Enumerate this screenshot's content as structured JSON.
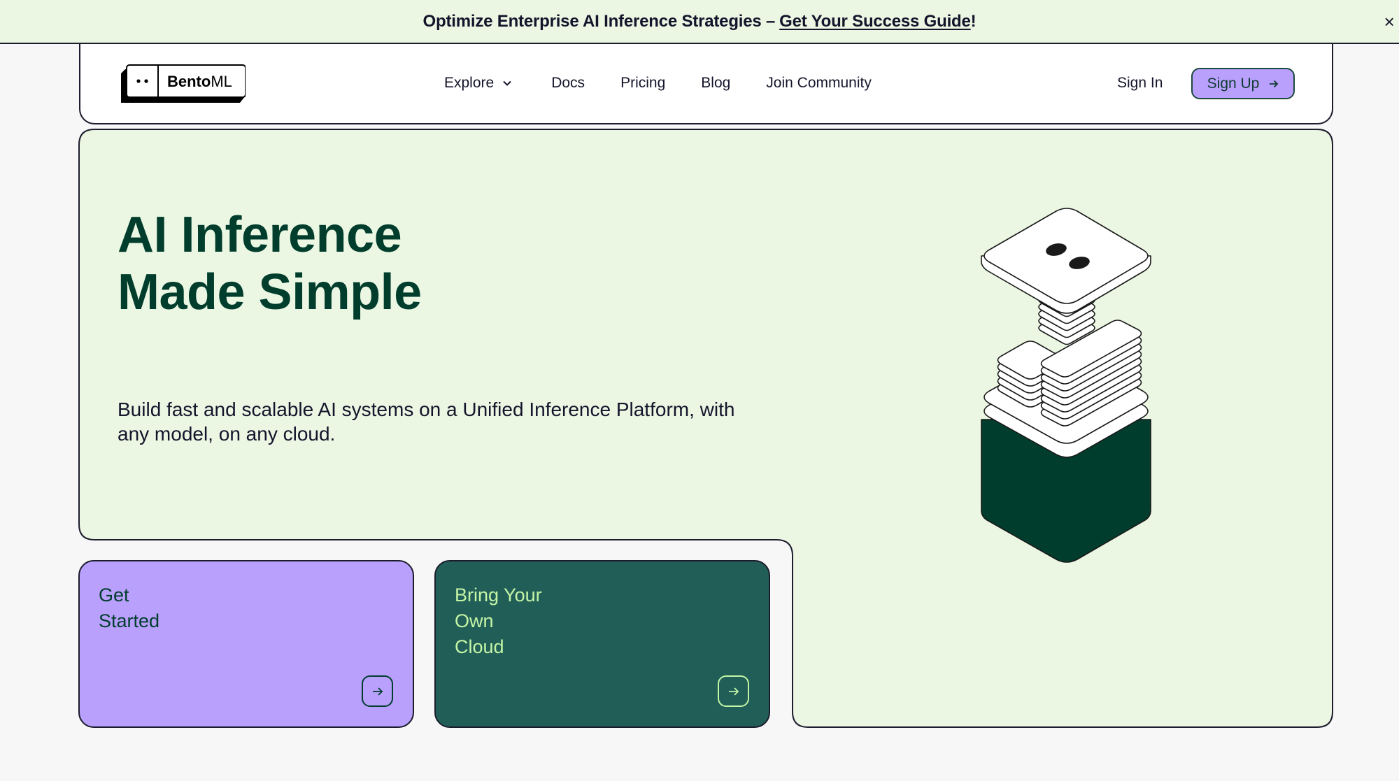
{
  "banner": {
    "text": "Optimize Enterprise AI Inference Strategies – ",
    "link": "Get Your Success Guide",
    "suffix": "!",
    "close_icon": "×"
  },
  "nav": {
    "logo_mark": "••",
    "logo_bold": "Bento",
    "logo_light": "ML",
    "links": [
      {
        "label": "Explore",
        "has_dropdown": true
      },
      {
        "label": "Docs"
      },
      {
        "label": "Pricing"
      },
      {
        "label": "Blog"
      },
      {
        "label": "Join Community"
      }
    ],
    "sign_in": "Sign In",
    "sign_up": "Sign Up",
    "sign_up_icon": "→"
  },
  "hero": {
    "title_line1": "AI Inference",
    "title_line2": "Made Simple",
    "subtitle": "Build fast and scalable AI systems on a Unified Inference Platform, with any model, on any cloud.",
    "illustration": "bento-stack-illustration"
  },
  "cards": [
    {
      "title": "Get\nStarted",
      "icon": "arrow-right-icon"
    },
    {
      "title": "Bring Your\nOwn\nCloud",
      "icon": "arrow-right-icon"
    }
  ],
  "colors": {
    "hero_bg": "#ebf7e3",
    "primary_dark": "#003d2c",
    "purple": "#b9a0fd",
    "teal": "#225e58",
    "light_green_text": "#c3f5a5",
    "page_bg": "#f7f7f7"
  }
}
